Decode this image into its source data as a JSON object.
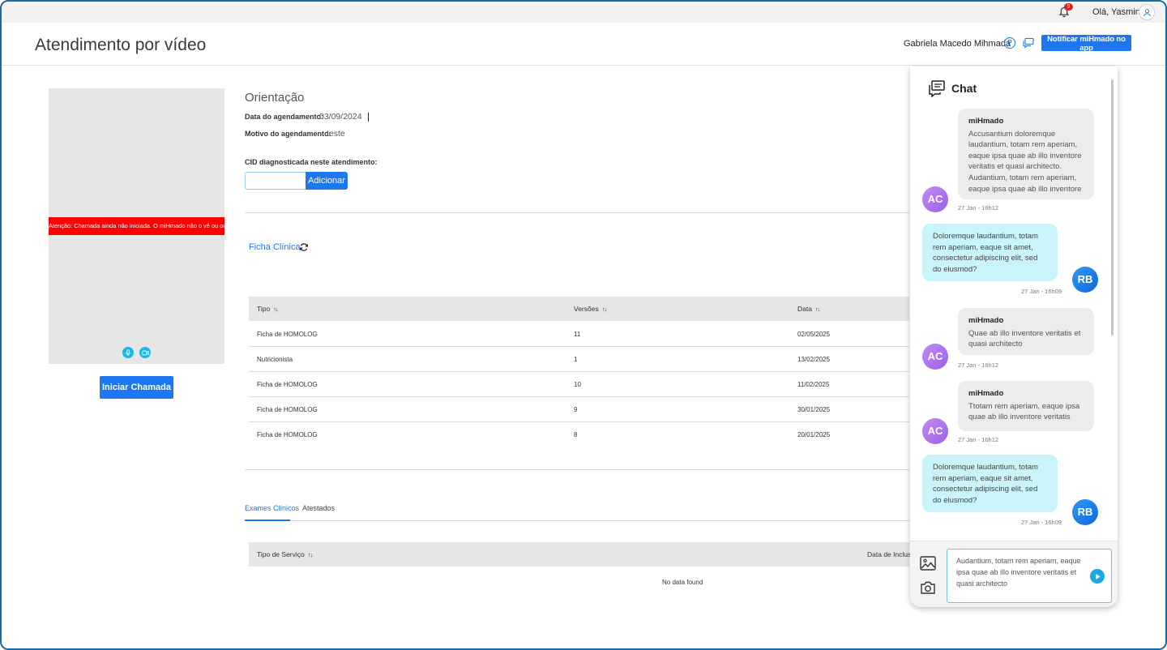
{
  "topbar": {
    "notification_count": "9",
    "greeting": "Olá, Yasmin!"
  },
  "header": {
    "title": "Atendimento por vídeo",
    "patient_name": "Gabriela Macedo Mihmada",
    "p_badge": "P",
    "notify_label": "Notificar miHmado no app"
  },
  "video": {
    "alert": "Atenção: Chamada ainda não iniciada. O miHmado não o vê ou ouve.",
    "start_label": "Iniciar Chamada"
  },
  "orientation": {
    "title": "Orientação",
    "date_label": "Data do agendamento:",
    "date_value": "03/09/2024",
    "reason_label": "Motivo do agendamento:",
    "reason_value": "teste",
    "cid_label": "CID diagnosticada neste atendimento:",
    "cid_value": "",
    "add_label": "Adicionar"
  },
  "ficha": {
    "link": "Ficha Clínica",
    "columns": [
      "Tipo",
      "Versões",
      "Data"
    ],
    "rows": [
      [
        "Ficha de HOMOLOG",
        "11",
        "02/05/2025"
      ],
      [
        "Nutricionista",
        "1",
        "13/02/2025"
      ],
      [
        "Ficha de HOMOLOG",
        "10",
        "11/02/2025"
      ],
      [
        "Ficha de HOMOLOG",
        "9",
        "30/01/2025"
      ],
      [
        "Ficha de HOMOLOG",
        "8",
        "20/01/2025"
      ]
    ]
  },
  "tabs": {
    "items": [
      "Exames Clínicos",
      "Atestados"
    ],
    "active": "Exames Clínicos"
  },
  "exams": {
    "columns": [
      "Tipo de Serviço",
      "Data de Inclusão"
    ],
    "empty": "No data found"
  },
  "chat": {
    "title": "Chat",
    "messages": [
      {
        "dir": "in",
        "sender": "miHmado",
        "avatar": "AC",
        "text": "Accusantium doloremque laudantium, totam rem aperiam, eaque ipsa quae ab illo inventore veritatis et quasi architecto. Audantium, totam rem aperiam, eaque ipsa quae ab illo inventore",
        "time": "27 Jan - 16h12"
      },
      {
        "dir": "out",
        "avatar": "RB",
        "text": "Doloremque laudantium, totam rem aperiam, eaque sit amet, consectetur adipiscing elit, sed do eiusmod?",
        "time": "27 Jan - 16h09"
      },
      {
        "dir": "in",
        "sender": "miHmado",
        "avatar": "AC",
        "text": "Quae ab illo inventore veritatis et quasi architecto",
        "time": "27 Jan - 16h12"
      },
      {
        "dir": "in",
        "sender": "miHmado",
        "avatar": "AC",
        "text": "Ttotam rem aperiam, eaque ipsa quae ab illo inventore veritatis",
        "time": "27 Jan - 16h12"
      },
      {
        "dir": "out",
        "avatar": "RB",
        "text": "Doloremque laudantium, totam rem aperiam, eaque sit amet, consectetur adipiscing elit, sed do eiusmod?",
        "time": "27 Jan - 16h09"
      }
    ],
    "input_value": "Audantium, totam rem aperiam, eaque ipsa quae ab illo inventore veritatis et quasi architecto"
  },
  "colors": {
    "primary": "#1e77f0",
    "alert": "#ff0000",
    "accent": "#18b7e6"
  }
}
